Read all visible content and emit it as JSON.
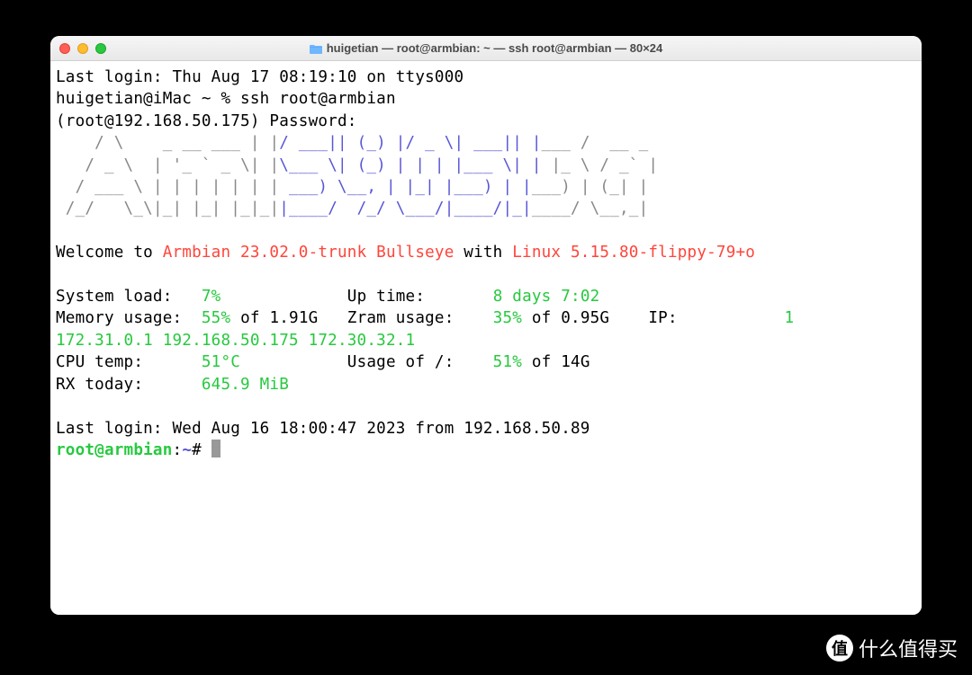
{
  "window": {
    "title": "huigetian — root@armbian: ~ — ssh root@armbian — 80×24"
  },
  "session": {
    "last_login": "Last login: Thu Aug 17 08:19:10 on ttys000",
    "local_prompt": "huigetian@iMac ~ % ssh root@armbian",
    "password_prompt": "(root@192.168.50.175) Password:"
  },
  "ascii": {
    "l1_a": "    / \\   ",
    "l1_b": " _ __ ___ | |",
    "l1_c": "/ ___|| (_) |/ _ \\| ___|| |",
    "l1_d": "___ /  __ _ ",
    "l2_a": "   / _ \\  ",
    "l2_b": "| '_ ` _ \\| |",
    "l2_c": "\\___ \\| (_) | | | |___ \\| |",
    "l2_d": " |_ \\ / _` |",
    "l3_a": "  / ___ \\ ",
    "l3_b": "| | | | | | |",
    "l3_c": " ___) \\__, | |_| |___) | |",
    "l3_d": "___) | (_| |",
    "l4_a": " /_/   \\_\\",
    "l4_b": "|_| |_| |_|_|",
    "l4_c": "|____/  /_/ \\___/|____/|_|",
    "l4_d": "____/ \\__,_|"
  },
  "welcome": {
    "prefix": "Welcome to ",
    "os": "Armbian 23.02.0-trunk Bullseye",
    "mid": " with ",
    "kernel": "Linux 5.15.80-flippy-79+o"
  },
  "stats": {
    "sysload_label": "System load:   ",
    "sysload_value": "7%",
    "uptime_label": "Up time:       ",
    "uptime_value": "8 days 7:02",
    "mem_label": "Memory usage:  ",
    "mem_value": "55%",
    "mem_rest": " of 1.91G   ",
    "zram_label": "Zram usage:    ",
    "zram_value": "35%",
    "zram_rest": " of 0.95G    ",
    "ip_label": "IP:           ",
    "ip_value": "172.31.0.1 192.168.50.175 172.30.32.1",
    "ip_tail": "1",
    "cpu_label": "CPU temp:      ",
    "cpu_value": "51°C",
    "usage_label": "Usage of /:    ",
    "usage_value": "51%",
    "usage_rest": " of 14G",
    "rx_label": "RX today:      ",
    "rx_value": "645.9 MiB"
  },
  "footer": {
    "lastlogin": "Last login: Wed Aug 16 18:00:47 2023 from 192.168.50.89",
    "prompt_user": "root@armbian",
    "prompt_sep": ":",
    "prompt_path": "~",
    "prompt_hash": "#"
  },
  "watermark": {
    "badge": "值",
    "text": "什么值得买"
  }
}
